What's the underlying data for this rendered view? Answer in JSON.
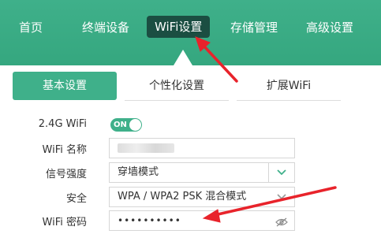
{
  "nav": {
    "items": [
      "首页",
      "终端设备",
      "WiFi设置",
      "存储管理",
      "高级设置"
    ],
    "active_index": 2
  },
  "tabs": [
    "基本设置",
    "个性化设置",
    "扩展WiFi"
  ],
  "form": {
    "band_label": "2.4G WiFi",
    "toggle_text": "ON",
    "ssid_label": "WiFi 名称",
    "signal_label": "信号强度",
    "signal_value": "穿墙模式",
    "security_label": "安全",
    "security_value": "WPA / WPA2 PSK 混合模式",
    "password_label": "WiFi 密码",
    "password_value": "••••••••••"
  },
  "colors": {
    "accent": "#3fb08a",
    "nav_active": "#1b4e42",
    "annotation_arrow": "#e8232b"
  },
  "icons": [
    "chevron-down-icon",
    "eye-slash-icon",
    "arrow-annotation-icon"
  ]
}
